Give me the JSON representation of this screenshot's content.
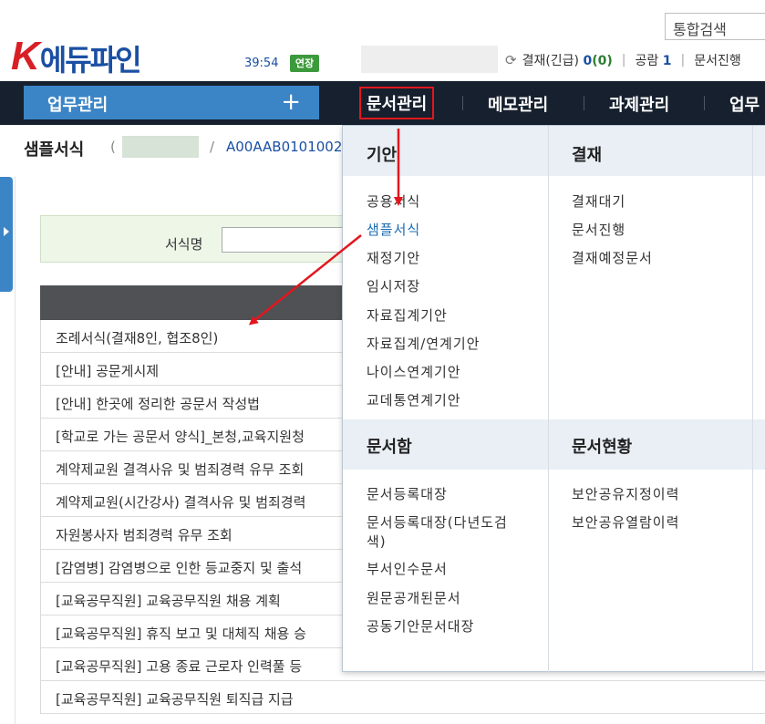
{
  "header": {
    "search_label": "통합검색",
    "logo_k": "K",
    "logo_rest": "에듀파인",
    "timer": "39:54",
    "extend_label": "연장",
    "info": {
      "approval_label": "결재(긴급)",
      "approval_count": "0",
      "approval_urgent": "(0)",
      "notice_label": "공람",
      "notice_count": "1",
      "progress_label": "문서진행"
    }
  },
  "nav": {
    "work_label": "업무관리",
    "work_plus": "+",
    "items": [
      {
        "label": "문서관리"
      },
      {
        "label": "메모관리"
      },
      {
        "label": "과제관리"
      },
      {
        "label": "업무"
      }
    ]
  },
  "breadcrumb": {
    "title": "샘플서식",
    "open_paren": "(",
    "slash": "/",
    "code": "A00AAB0101002"
  },
  "search_panel": {
    "label": "서식명",
    "value": ""
  },
  "list": {
    "items": [
      "조례서식(결재8인, 협조8인)",
      "[안내] 공문게시제",
      "[안내] 한곳에 정리한 공문서 작성법",
      "[학교로 가는 공문서 양식]_본청,교육지원청",
      "계약제교원 결격사유 및 범죄경력 유무 조회",
      "계약제교원(시간강사) 결격사유 및 범죄경력",
      "자원봉사자 범죄경력 유무 조회",
      "[감염병] 감염병으로 인한 등교중지 및 출석",
      "[교육공무직원] 교육공무직원 채용 계획",
      "[교육공무직원] 휴직 보고 및 대체직 채용 승",
      "[교육공무직원] 고용 종료 근로자 인력풀 등",
      "[교육공무직원] 교육공무직원 퇴직급 지급"
    ]
  },
  "dropdown": {
    "draft": {
      "title": "기안",
      "items": [
        "공용서식",
        "샘플서식",
        "재정기안",
        "임시저장",
        "자료집계기안",
        "자료집계/연계기안",
        "나이스연계기안",
        "교데통연계기안"
      ]
    },
    "approval": {
      "title": "결재",
      "items": [
        "결재대기",
        "문서진행",
        "결재예정문서"
      ]
    },
    "docbox": {
      "title": "문서함",
      "items": [
        "문서등록대장",
        "문서등록대장(다년도검",
        "색)",
        "부서인수문서",
        "원문공개된문서",
        "공동기안문서대장"
      ]
    },
    "status": {
      "title": "문서현황",
      "items": [
        "보안공유지정이력",
        "보안공유열람이력"
      ]
    }
  },
  "colors": {
    "navbar": "#16202e",
    "work_button": "#3b85c7",
    "highlight_red": "#e3161d",
    "extend_green": "#3c9a3c"
  }
}
